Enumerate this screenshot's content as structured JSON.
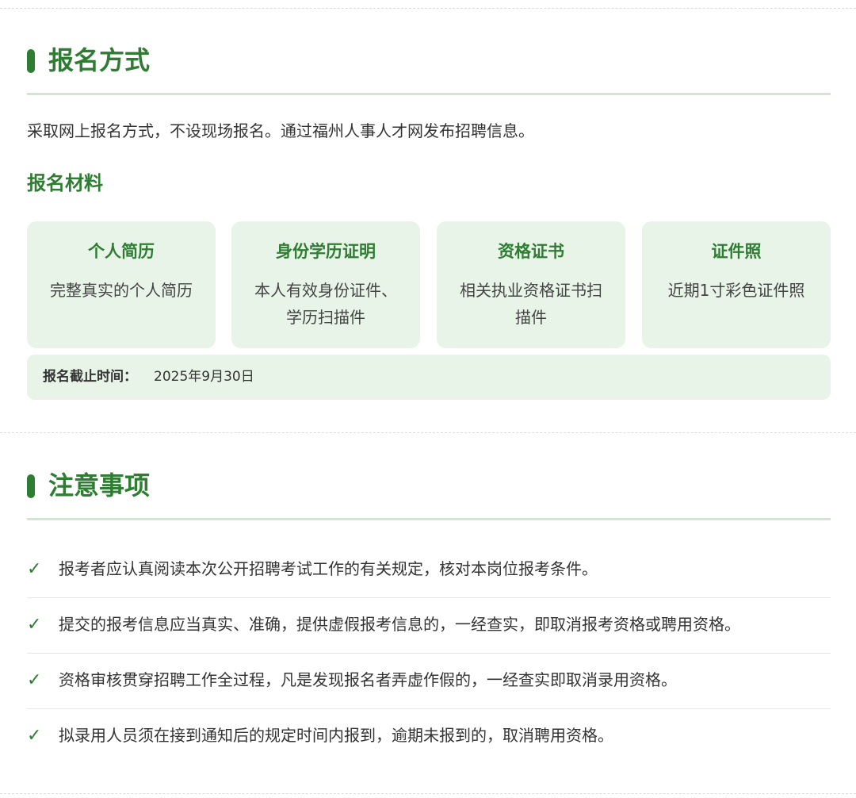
{
  "registration": {
    "title": "报名方式",
    "intro": "采取网上报名方式，不设现场报名。通过福州人事人才网发布招聘信息。",
    "materials_title": "报名材料",
    "materials": [
      {
        "title": "个人简历",
        "desc": "完整真实的个人简历"
      },
      {
        "title": "身份学历证明",
        "desc": "本人有效身份证件、学历扫描件"
      },
      {
        "title": "资格证书",
        "desc": "相关执业资格证书扫描件"
      },
      {
        "title": "证件照",
        "desc": "近期1寸彩色证件照"
      }
    ],
    "deadline_label": "报名截止时间：",
    "deadline_value": "2025年9月30日"
  },
  "notes": {
    "title": "注意事项",
    "check_icon": "check-icon",
    "items": [
      "报考者应认真阅读本次公开招聘考试工作的有关规定，核对本岗位报考条件。",
      "提交的报考信息应当真实、准确，提供虚假报考信息的，一经查实，即取消报考资格或聘用资格。",
      "资格审核贯穿招聘工作全过程，凡是发现报名者弄虚作假的，一经查实即取消录用资格。",
      "拟录用人员须在接到通知后的规定时间内报到，逾期未报到的，取消聘用资格。"
    ]
  },
  "colors": {
    "accent": "#2e7d32",
    "card_bg": "#e7f4e7",
    "underline": "#cfe8cf"
  }
}
